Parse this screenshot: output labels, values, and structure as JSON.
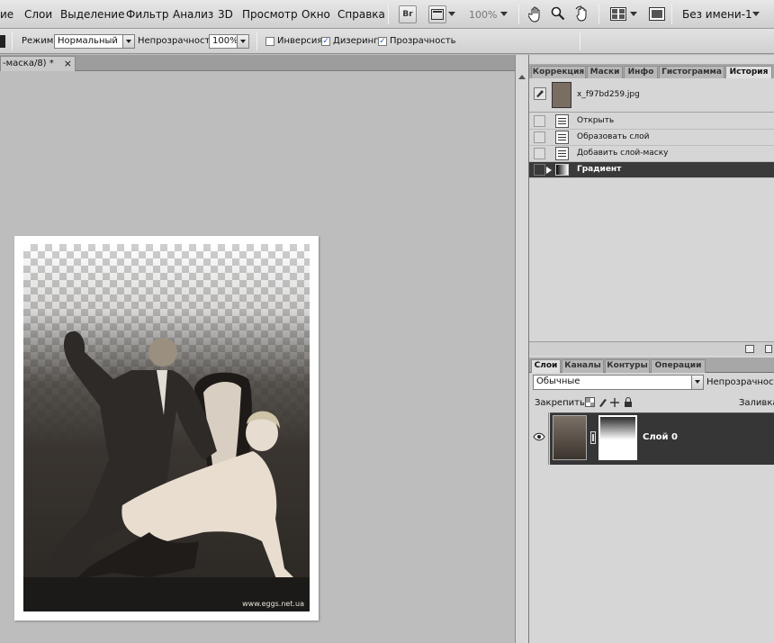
{
  "menubar": {
    "items": [
      "ие",
      "Слои",
      "Выделение",
      "Фильтр",
      "Анализ",
      "3D",
      "Просмотр",
      "Окно",
      "Справка"
    ],
    "br_label": "Br",
    "zoom": "100%",
    "workspace": "Без имени-1"
  },
  "options": {
    "mode_label": "Режим:",
    "mode_value": "Нормальный",
    "opacity_label": "Непрозрачность:",
    "opacity_value": "100%",
    "reverse_label": "Инверсия",
    "dither_label": "Дизеринг",
    "transparency_label": "Прозрачность",
    "reverse_checked": false,
    "dither_checked": true,
    "transparency_checked": true
  },
  "document": {
    "tab_title": "-маска/8) *",
    "close_glyph": "×",
    "watermark": "www.eggs.net.ua"
  },
  "history_panel": {
    "tabs": [
      "Коррекция",
      "Маски",
      "Инфо",
      "Гистограмма",
      "История"
    ],
    "active_tab": "История",
    "snapshot": "x_f97bd259.jpg",
    "steps": [
      "Открыть",
      "Образовать слой",
      "Добавить слой-маску",
      "Градиент"
    ],
    "active_step": "Градиент"
  },
  "layers_panel": {
    "tabs": [
      "Слои",
      "Каналы",
      "Контуры",
      "Операции"
    ],
    "active_tab": "Слои",
    "blend_mode": "Обычные",
    "opacity_label": "Непрозрачность:",
    "lock_label": "Закрепить:",
    "fill_label": "Заливка:",
    "layers": [
      {
        "name": "Слой 0",
        "visible": true
      }
    ]
  }
}
